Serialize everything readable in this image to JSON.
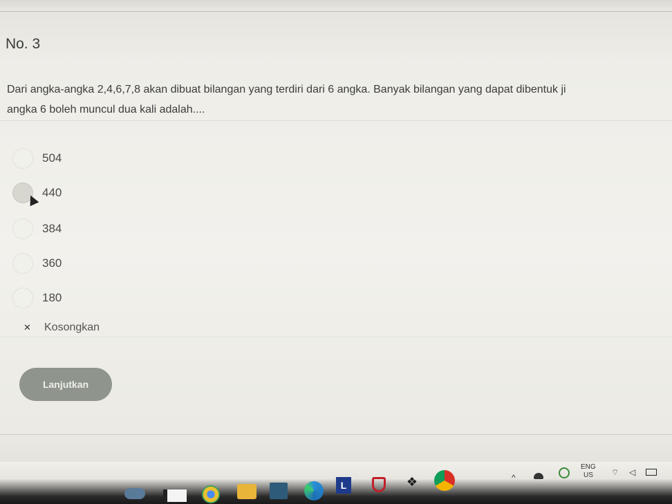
{
  "question": {
    "number": "No. 3",
    "text_line1": "Dari angka-angka 2,4,6,7,8 akan dibuat bilangan yang terdiri dari 6 angka. Banyak bilangan yang dapat dibentuk ji",
    "text_line2": "angka 6 boleh muncul dua kali adalah...."
  },
  "options": [
    "504",
    "440",
    "384",
    "360",
    "180"
  ],
  "clear_label": "Kosongkan",
  "clear_icon": "x-icon",
  "next_button": "Lanjutkan",
  "taskbar": {
    "icons": [
      "photos-icon",
      "file-icon",
      "chrome-icon",
      "folder-icon",
      "store-icon",
      "edge-icon",
      "l-app-icon",
      "mcafee-icon",
      "dropbox-icon",
      "chrome-badge-icon"
    ],
    "tray": {
      "lang": "ENG",
      "region": "US"
    }
  }
}
